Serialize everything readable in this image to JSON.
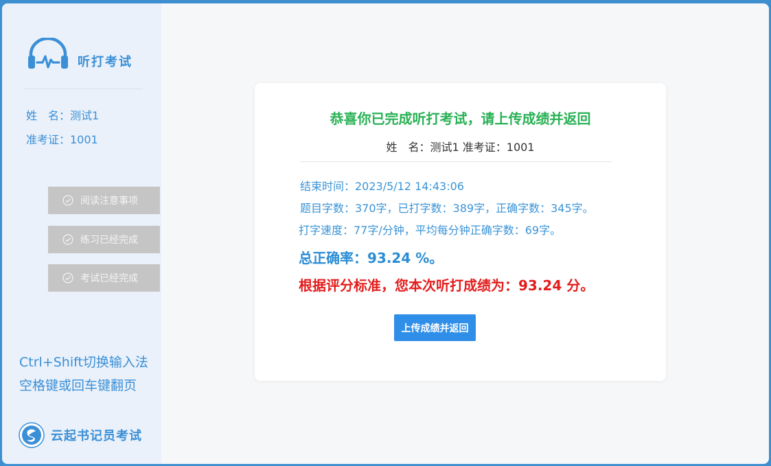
{
  "app": {
    "title": "听打考试",
    "logo_icon": "headphones-heartbeat-icon"
  },
  "candidate": {
    "name_line": "姓　名：测试1",
    "exam_id_line": "准考证：1001"
  },
  "steps": [
    {
      "label": "阅读注意事项",
      "icon": "check-circle-icon"
    },
    {
      "label": "练习已经完成",
      "icon": "check-circle-icon"
    },
    {
      "label": "考试已经完成",
      "icon": "check-circle-icon"
    }
  ],
  "tips": {
    "line1": "Ctrl+Shift切换输入法",
    "line2": "空格键或回车键翻页"
  },
  "brand": {
    "name": "云起书记员考试",
    "icon": "yunqi-logo-icon"
  },
  "result": {
    "title": "恭喜你已完成听打考试，请上传成绩并返回",
    "subtitle": "姓　名：测试1 准考证：1001",
    "end_time": "结束时间：2023/5/12 14:43:06",
    "char_counts": "题目字数：370字，已打字数：389字，正确字数：345字。",
    "speed": "打字速度：77字/分钟，平均每分钟正确字数：69字。",
    "accuracy": "总正确率：93.24 %。",
    "score": "根据评分标准，您本次听打成绩为：93.24 分。",
    "upload_button": "上传成绩并返回"
  },
  "colors": {
    "frame": "#3d8fd0",
    "accent": "#3b8fd6",
    "success": "#29b155",
    "danger": "#e31c1c",
    "button": "#2f8fe8",
    "step_bg": "#c5c5c5"
  }
}
